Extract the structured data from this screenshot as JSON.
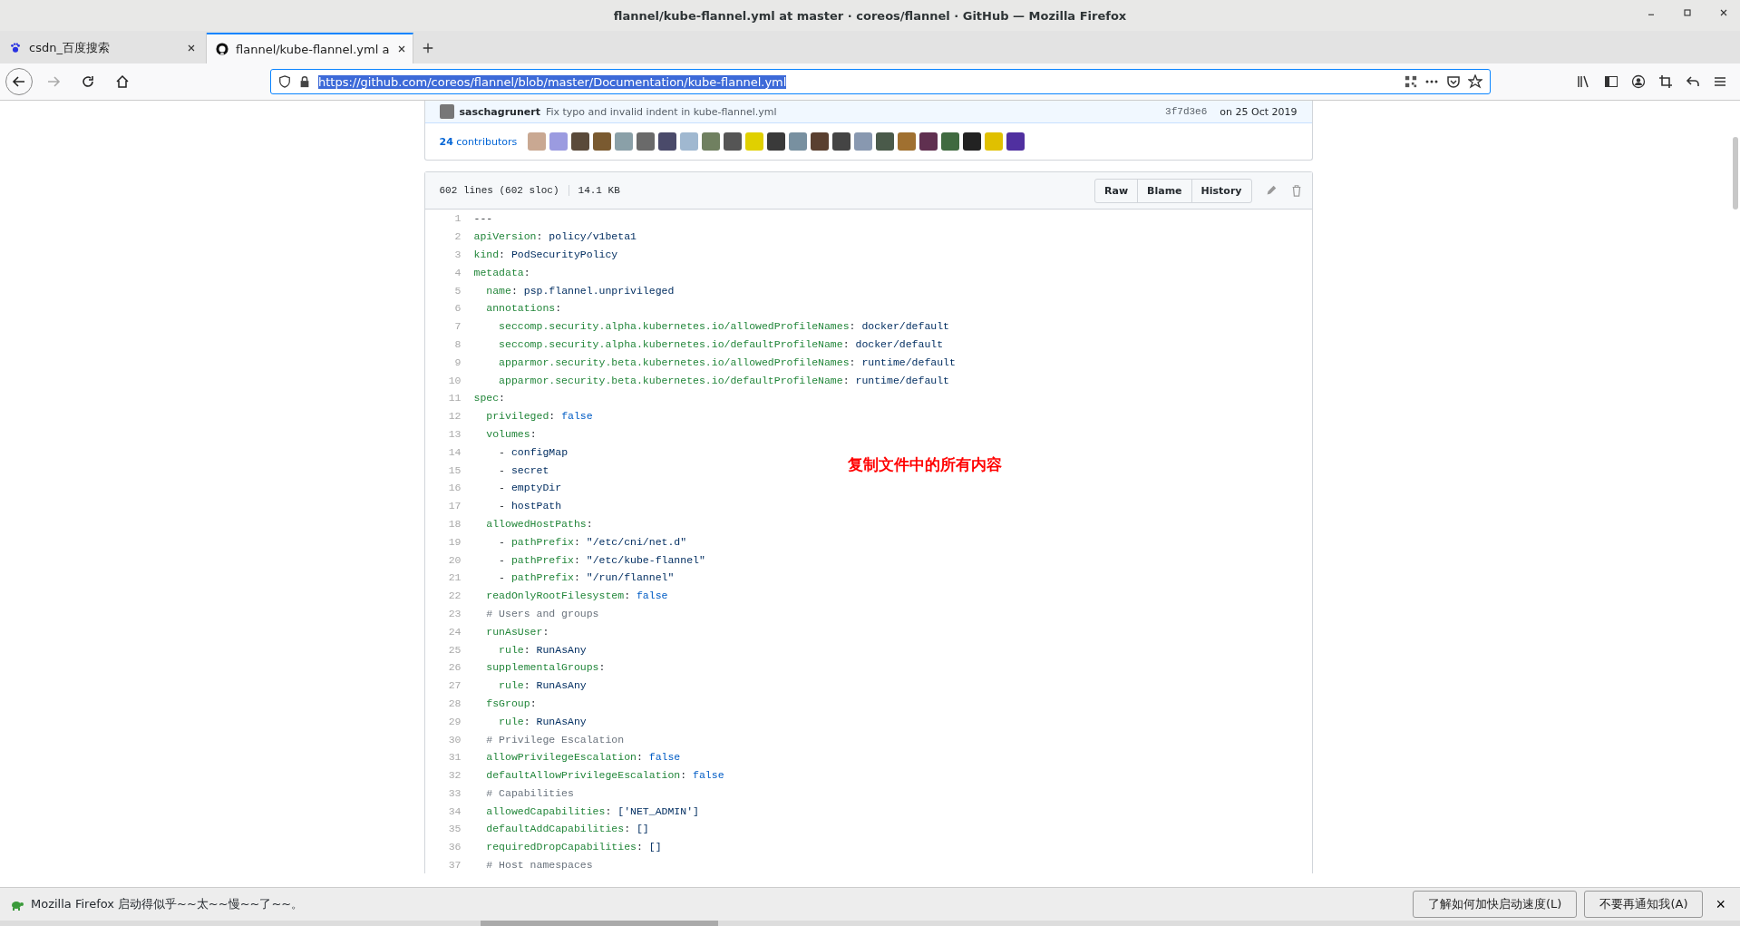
{
  "window": {
    "title": "flannel/kube-flannel.yml at master · coreos/flannel · GitHub — Mozilla Firefox"
  },
  "tabs": [
    {
      "label": "csdn_百度搜索",
      "selected": false
    },
    {
      "label": "flannel/kube-flannel.yml a",
      "selected": true
    }
  ],
  "address_bar": {
    "url": "https://github.com/coreos/flannel/blob/master/Documentation/kube-flannel.yml",
    "selected": true
  },
  "commit": {
    "author": "saschagrunert",
    "message": "Fix typo and invalid indent in kube-flannel.yml",
    "sha": "3f7d3e6",
    "date": "on 25 Oct 2019"
  },
  "contributors": {
    "count": "24",
    "label": "contributors"
  },
  "file": {
    "lines": "602 lines (602 sloc)",
    "size": "14.1 KB",
    "buttons": [
      "Raw",
      "Blame",
      "History"
    ]
  },
  "code": [
    {
      "n": "1",
      "s": [
        {
          "kind": "punct",
          "t": "---"
        }
      ]
    },
    {
      "n": "2",
      "s": [
        {
          "kind": "key",
          "t": "apiVersion"
        },
        {
          "kind": "punct",
          "t": ": "
        },
        {
          "kind": "val",
          "t": "policy/v1beta1"
        }
      ]
    },
    {
      "n": "3",
      "s": [
        {
          "kind": "key",
          "t": "kind"
        },
        {
          "kind": "punct",
          "t": ": "
        },
        {
          "kind": "val",
          "t": "PodSecurityPolicy"
        }
      ]
    },
    {
      "n": "4",
      "s": [
        {
          "kind": "key",
          "t": "metadata"
        },
        {
          "kind": "punct",
          "t": ":"
        }
      ]
    },
    {
      "n": "5",
      "s": [
        {
          "kind": "key",
          "t": "  name"
        },
        {
          "kind": "punct",
          "t": ": "
        },
        {
          "kind": "val",
          "t": "psp.flannel.unprivileged"
        }
      ]
    },
    {
      "n": "6",
      "s": [
        {
          "kind": "key",
          "t": "  annotations"
        },
        {
          "kind": "punct",
          "t": ":"
        }
      ]
    },
    {
      "n": "7",
      "s": [
        {
          "kind": "key",
          "t": "    seccomp.security.alpha.kubernetes.io/allowedProfileNames"
        },
        {
          "kind": "punct",
          "t": ": "
        },
        {
          "kind": "val",
          "t": "docker/default"
        }
      ]
    },
    {
      "n": "8",
      "s": [
        {
          "kind": "key",
          "t": "    seccomp.security.alpha.kubernetes.io/defaultProfileName"
        },
        {
          "kind": "punct",
          "t": ": "
        },
        {
          "kind": "val",
          "t": "docker/default"
        }
      ]
    },
    {
      "n": "9",
      "s": [
        {
          "kind": "key",
          "t": "    apparmor.security.beta.kubernetes.io/allowedProfileNames"
        },
        {
          "kind": "punct",
          "t": ": "
        },
        {
          "kind": "val",
          "t": "runtime/default"
        }
      ]
    },
    {
      "n": "10",
      "s": [
        {
          "kind": "key",
          "t": "    apparmor.security.beta.kubernetes.io/defaultProfileName"
        },
        {
          "kind": "punct",
          "t": ": "
        },
        {
          "kind": "val",
          "t": "runtime/default"
        }
      ]
    },
    {
      "n": "11",
      "s": [
        {
          "kind": "key",
          "t": "spec"
        },
        {
          "kind": "punct",
          "t": ":"
        }
      ]
    },
    {
      "n": "12",
      "s": [
        {
          "kind": "key",
          "t": "  privileged"
        },
        {
          "kind": "punct",
          "t": ": "
        },
        {
          "kind": "lit",
          "t": "false"
        }
      ]
    },
    {
      "n": "13",
      "s": [
        {
          "kind": "key",
          "t": "  volumes"
        },
        {
          "kind": "punct",
          "t": ":"
        }
      ]
    },
    {
      "n": "14",
      "s": [
        {
          "kind": "punct",
          "t": "    - "
        },
        {
          "kind": "val",
          "t": "configMap"
        }
      ]
    },
    {
      "n": "15",
      "s": [
        {
          "kind": "punct",
          "t": "    - "
        },
        {
          "kind": "val",
          "t": "secret"
        }
      ]
    },
    {
      "n": "16",
      "s": [
        {
          "kind": "punct",
          "t": "    - "
        },
        {
          "kind": "val",
          "t": "emptyDir"
        }
      ]
    },
    {
      "n": "17",
      "s": [
        {
          "kind": "punct",
          "t": "    - "
        },
        {
          "kind": "val",
          "t": "hostPath"
        }
      ]
    },
    {
      "n": "18",
      "s": [
        {
          "kind": "key",
          "t": "  allowedHostPaths"
        },
        {
          "kind": "punct",
          "t": ":"
        }
      ]
    },
    {
      "n": "19",
      "s": [
        {
          "kind": "punct",
          "t": "    - "
        },
        {
          "kind": "key",
          "t": "pathPrefix"
        },
        {
          "kind": "punct",
          "t": ": "
        },
        {
          "kind": "val",
          "t": "\"/etc/cni/net.d\""
        }
      ]
    },
    {
      "n": "20",
      "s": [
        {
          "kind": "punct",
          "t": "    - "
        },
        {
          "kind": "key",
          "t": "pathPrefix"
        },
        {
          "kind": "punct",
          "t": ": "
        },
        {
          "kind": "val",
          "t": "\"/etc/kube-flannel\""
        }
      ]
    },
    {
      "n": "21",
      "s": [
        {
          "kind": "punct",
          "t": "    - "
        },
        {
          "kind": "key",
          "t": "pathPrefix"
        },
        {
          "kind": "punct",
          "t": ": "
        },
        {
          "kind": "val",
          "t": "\"/run/flannel\""
        }
      ]
    },
    {
      "n": "22",
      "s": [
        {
          "kind": "key",
          "t": "  readOnlyRootFilesystem"
        },
        {
          "kind": "punct",
          "t": ": "
        },
        {
          "kind": "lit",
          "t": "false"
        }
      ]
    },
    {
      "n": "23",
      "s": [
        {
          "kind": "com",
          "t": "  # Users and groups"
        }
      ]
    },
    {
      "n": "24",
      "s": [
        {
          "kind": "key",
          "t": "  runAsUser"
        },
        {
          "kind": "punct",
          "t": ":"
        }
      ]
    },
    {
      "n": "25",
      "s": [
        {
          "kind": "key",
          "t": "    rule"
        },
        {
          "kind": "punct",
          "t": ": "
        },
        {
          "kind": "val",
          "t": "RunAsAny"
        }
      ]
    },
    {
      "n": "26",
      "s": [
        {
          "kind": "key",
          "t": "  supplementalGroups"
        },
        {
          "kind": "punct",
          "t": ":"
        }
      ]
    },
    {
      "n": "27",
      "s": [
        {
          "kind": "key",
          "t": "    rule"
        },
        {
          "kind": "punct",
          "t": ": "
        },
        {
          "kind": "val",
          "t": "RunAsAny"
        }
      ]
    },
    {
      "n": "28",
      "s": [
        {
          "kind": "key",
          "t": "  fsGroup"
        },
        {
          "kind": "punct",
          "t": ":"
        }
      ]
    },
    {
      "n": "29",
      "s": [
        {
          "kind": "key",
          "t": "    rule"
        },
        {
          "kind": "punct",
          "t": ": "
        },
        {
          "kind": "val",
          "t": "RunAsAny"
        }
      ]
    },
    {
      "n": "30",
      "s": [
        {
          "kind": "com",
          "t": "  # Privilege Escalation"
        }
      ]
    },
    {
      "n": "31",
      "s": [
        {
          "kind": "key",
          "t": "  allowPrivilegeEscalation"
        },
        {
          "kind": "punct",
          "t": ": "
        },
        {
          "kind": "lit",
          "t": "false"
        }
      ]
    },
    {
      "n": "32",
      "s": [
        {
          "kind": "key",
          "t": "  defaultAllowPrivilegeEscalation"
        },
        {
          "kind": "punct",
          "t": ": "
        },
        {
          "kind": "lit",
          "t": "false"
        }
      ]
    },
    {
      "n": "33",
      "s": [
        {
          "kind": "com",
          "t": "  # Capabilities"
        }
      ]
    },
    {
      "n": "34",
      "s": [
        {
          "kind": "key",
          "t": "  allowedCapabilities"
        },
        {
          "kind": "punct",
          "t": ": "
        },
        {
          "kind": "val",
          "t": "['NET_ADMIN']"
        }
      ]
    },
    {
      "n": "35",
      "s": [
        {
          "kind": "key",
          "t": "  defaultAddCapabilities"
        },
        {
          "kind": "punct",
          "t": ": "
        },
        {
          "kind": "val",
          "t": "[]"
        }
      ]
    },
    {
      "n": "36",
      "s": [
        {
          "kind": "key",
          "t": "  requiredDropCapabilities"
        },
        {
          "kind": "punct",
          "t": ": "
        },
        {
          "kind": "val",
          "t": "[]"
        }
      ]
    },
    {
      "n": "37",
      "s": [
        {
          "kind": "com",
          "t": "  # Host namespaces"
        }
      ]
    }
  ],
  "annotation": "复制文件中的所有内容",
  "notification": {
    "message": "Mozilla Firefox 启动得似乎~~太~~慢~~了~~。",
    "buttons": [
      "了解如何加快启动速度(L)",
      "不要再通知我(A)"
    ],
    "close": "×"
  }
}
